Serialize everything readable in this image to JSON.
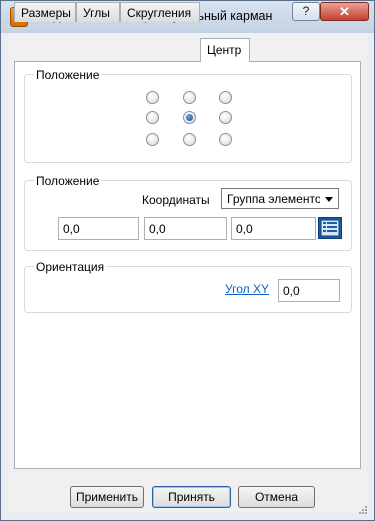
{
  "window": {
    "title": "Создать элемент Прямоугольный карман",
    "app_icon_letter": "P",
    "help_label": "?",
    "close_label": "✕"
  },
  "tabs": [
    {
      "label": "Размеры",
      "active": false
    },
    {
      "label": "Углы",
      "active": false
    },
    {
      "label": "Скругления",
      "active": false
    },
    {
      "label": "Центр",
      "active": true
    }
  ],
  "position_group": {
    "title": "Положение",
    "selected_anchor": "center"
  },
  "coords_group": {
    "title": "Положение",
    "coords_label": "Координаты",
    "mode_select_value": "Группа элементов",
    "x_value": "0,0",
    "y_value": "0,0",
    "z_value": "0,0"
  },
  "orientation_group": {
    "title": "Ориентация",
    "angle_link": "Угол XY",
    "angle_value": "0,0"
  },
  "buttons": {
    "apply": "Применить",
    "accept": "Принять",
    "cancel": "Отмена"
  },
  "colors": {
    "accent": "#124a8a",
    "link": "#1060c0",
    "close_button": "#c2402f"
  }
}
